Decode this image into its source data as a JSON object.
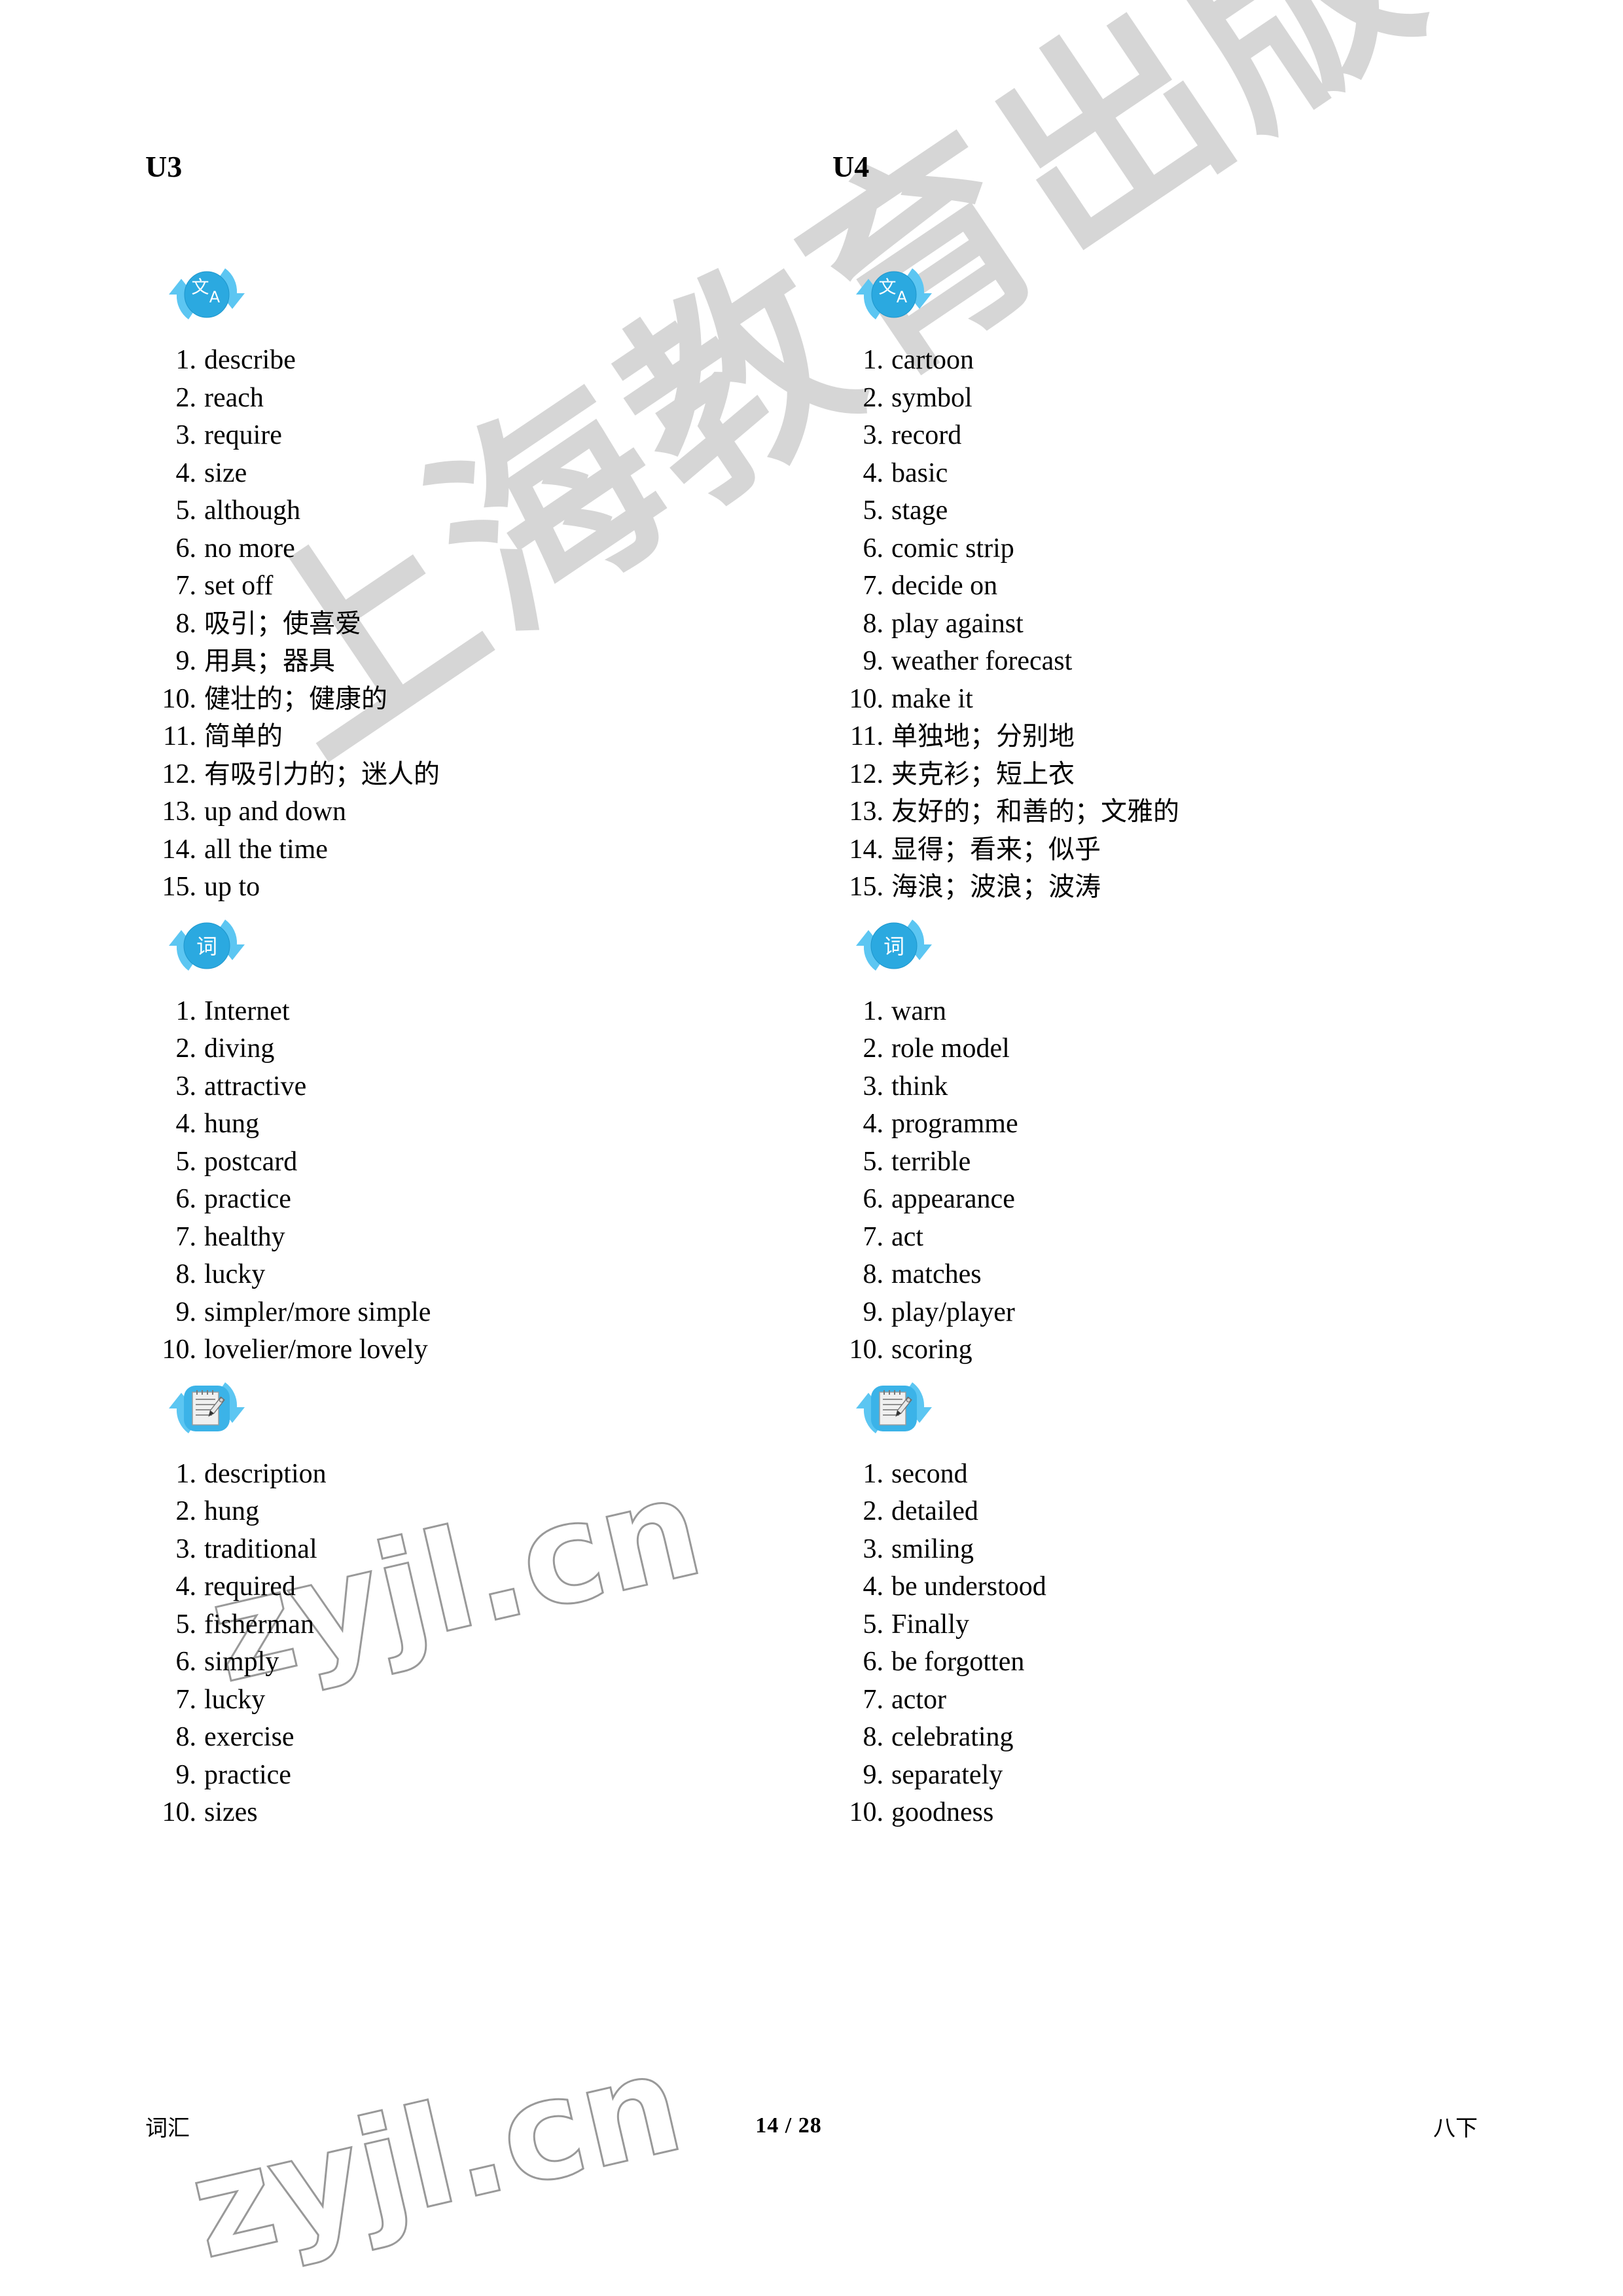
{
  "page": {
    "footer_left": "词汇",
    "footer_center": "14 / 28",
    "footer_right": "八下"
  },
  "watermarks": {
    "publisher": "上海教育出版社",
    "site": "zyjl.cn"
  },
  "colors": {
    "icon_blue": "#2BA9E0",
    "icon_arrow_blue": "#4FC3F0",
    "text": "#000000",
    "watermark_gray": "#BFBFBF"
  },
  "columns": [
    {
      "title": "U3",
      "sections": [
        {
          "icon": "translate-icon",
          "icon_glyphs": [
            "文",
            "A"
          ],
          "items": [
            {
              "num": "1.",
              "text": "describe",
              "lang": "en"
            },
            {
              "num": "2.",
              "text": "reach",
              "lang": "en"
            },
            {
              "num": "3.",
              "text": "require",
              "lang": "en"
            },
            {
              "num": "4.",
              "text": "size",
              "lang": "en"
            },
            {
              "num": "5.",
              "text": "although",
              "lang": "en"
            },
            {
              "num": "6.",
              "text": "no more",
              "lang": "en"
            },
            {
              "num": "7.",
              "text": "set off",
              "lang": "en"
            },
            {
              "num": "8.",
              "text": "吸引；使喜爱",
              "lang": "cn"
            },
            {
              "num": "9.",
              "text": "用具；器具",
              "lang": "cn"
            },
            {
              "num": "10.",
              "text": "健壮的；健康的",
              "lang": "cn"
            },
            {
              "num": "11.",
              "text": "简单的",
              "lang": "cn"
            },
            {
              "num": "12.",
              "text": "有吸引力的；迷人的",
              "lang": "cn"
            },
            {
              "num": "13.",
              "text": "up and down",
              "lang": "en"
            },
            {
              "num": "14.",
              "text": "all the time",
              "lang": "en"
            },
            {
              "num": "15.",
              "text": "up to",
              "lang": "en"
            }
          ]
        },
        {
          "icon": "word-icon",
          "icon_glyphs": [
            "词"
          ],
          "items": [
            {
              "num": "1.",
              "text": "Internet",
              "lang": "en"
            },
            {
              "num": "2.",
              "text": "diving",
              "lang": "en"
            },
            {
              "num": "3.",
              "text": "attractive",
              "lang": "en"
            },
            {
              "num": "4.",
              "text": "hung",
              "lang": "en"
            },
            {
              "num": "5.",
              "text": "postcard",
              "lang": "en"
            },
            {
              "num": "6.",
              "text": "practice",
              "lang": "en"
            },
            {
              "num": "7.",
              "text": "healthy",
              "lang": "en"
            },
            {
              "num": "8.",
              "text": "lucky",
              "lang": "en"
            },
            {
              "num": "9.",
              "text": "simpler/more simple",
              "lang": "en"
            },
            {
              "num": "10.",
              "text": "lovelier/more lovely",
              "lang": "en"
            }
          ]
        },
        {
          "icon": "notepad-pen-icon",
          "icon_glyphs": [],
          "items": [
            {
              "num": "1.",
              "text": "description",
              "lang": "en"
            },
            {
              "num": "2.",
              "text": "hung",
              "lang": "en"
            },
            {
              "num": "3.",
              "text": "traditional",
              "lang": "en"
            },
            {
              "num": "4.",
              "text": "required",
              "lang": "en"
            },
            {
              "num": "5.",
              "text": "fisherman",
              "lang": "en"
            },
            {
              "num": "6.",
              "text": "simply",
              "lang": "en"
            },
            {
              "num": "7.",
              "text": "lucky",
              "lang": "en"
            },
            {
              "num": "8.",
              "text": "exercise",
              "lang": "en"
            },
            {
              "num": "9.",
              "text": "practice",
              "lang": "en"
            },
            {
              "num": "10.",
              "text": "sizes",
              "lang": "en"
            }
          ]
        }
      ]
    },
    {
      "title": "U4",
      "sections": [
        {
          "icon": "translate-icon",
          "icon_glyphs": [
            "文",
            "A"
          ],
          "items": [
            {
              "num": "1.",
              "text": "cartoon",
              "lang": "en"
            },
            {
              "num": "2.",
              "text": "symbol",
              "lang": "en"
            },
            {
              "num": "3.",
              "text": "record",
              "lang": "en"
            },
            {
              "num": "4.",
              "text": "basic",
              "lang": "en"
            },
            {
              "num": "5.",
              "text": "stage",
              "lang": "en"
            },
            {
              "num": "6.",
              "text": "comic strip",
              "lang": "en"
            },
            {
              "num": "7.",
              "text": "decide on",
              "lang": "en"
            },
            {
              "num": "8.",
              "text": "play against",
              "lang": "en"
            },
            {
              "num": "9.",
              "text": "weather forecast",
              "lang": "en"
            },
            {
              "num": "10.",
              "text": "make it",
              "lang": "en"
            },
            {
              "num": "11.",
              "text": "单独地；分别地",
              "lang": "cn"
            },
            {
              "num": "12.",
              "text": "夹克衫；短上衣",
              "lang": "cn"
            },
            {
              "num": "13.",
              "text": "友好的；和善的；文雅的",
              "lang": "cn"
            },
            {
              "num": "14.",
              "text": "显得；看来；似乎",
              "lang": "cn"
            },
            {
              "num": "15.",
              "text": "海浪；波浪；波涛",
              "lang": "cn"
            }
          ]
        },
        {
          "icon": "word-icon",
          "icon_glyphs": [
            "词"
          ],
          "items": [
            {
              "num": "1.",
              "text": "warn",
              "lang": "en"
            },
            {
              "num": "2.",
              "text": "role model",
              "lang": "en"
            },
            {
              "num": "3.",
              "text": "think",
              "lang": "en"
            },
            {
              "num": "4.",
              "text": "programme",
              "lang": "en"
            },
            {
              "num": "5.",
              "text": "terrible",
              "lang": "en"
            },
            {
              "num": "6.",
              "text": "appearance",
              "lang": "en"
            },
            {
              "num": "7.",
              "text": "act",
              "lang": "en"
            },
            {
              "num": "8.",
              "text": "matches",
              "lang": "en"
            },
            {
              "num": "9.",
              "text": "play/player",
              "lang": "en"
            },
            {
              "num": "10.",
              "text": "scoring",
              "lang": "en"
            }
          ]
        },
        {
          "icon": "notepad-pen-icon",
          "icon_glyphs": [],
          "items": [
            {
              "num": "1.",
              "text": "second",
              "lang": "en"
            },
            {
              "num": "2.",
              "text": "detailed",
              "lang": "en"
            },
            {
              "num": "3.",
              "text": "smiling",
              "lang": "en"
            },
            {
              "num": "4.",
              "text": "be understood",
              "lang": "en"
            },
            {
              "num": "5.",
              "text": "Finally",
              "lang": "en"
            },
            {
              "num": "6.",
              "text": "be forgotten",
              "lang": "en"
            },
            {
              "num": "7.",
              "text": "actor",
              "lang": "en"
            },
            {
              "num": "8.",
              "text": "celebrating",
              "lang": "en"
            },
            {
              "num": "9.",
              "text": "separately",
              "lang": "en"
            },
            {
              "num": "10.",
              "text": "goodness",
              "lang": "en"
            }
          ]
        }
      ]
    }
  ]
}
